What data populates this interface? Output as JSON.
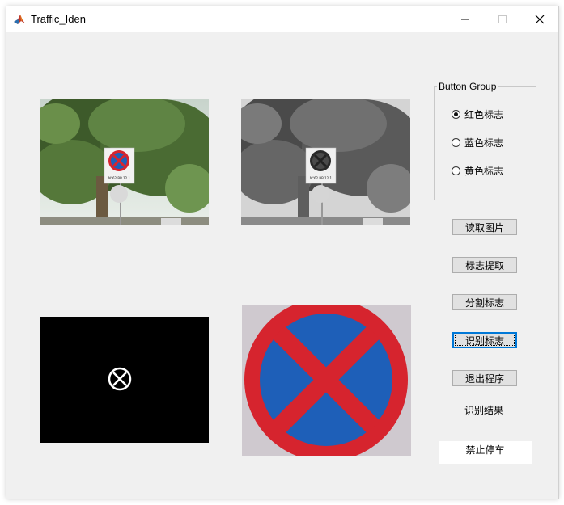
{
  "window": {
    "title": "Traffic_Iden"
  },
  "button_group": {
    "title": "Button Group",
    "options": [
      {
        "label": "红色标志",
        "selected": true
      },
      {
        "label": "蓝色标志",
        "selected": false
      },
      {
        "label": "黄色标志",
        "selected": false
      }
    ]
  },
  "buttons": {
    "read_image": "读取图片",
    "extract_sign": "标志提取",
    "segment_sign": "分割标志",
    "recognize_sign": "识别标志",
    "exit_program": "退出程序"
  },
  "result": {
    "label": "识别结果",
    "value": "禁止停车"
  },
  "images": {
    "plate_text": "N°62 BB 12 1"
  },
  "colors": {
    "window_bg": "#f0f0f0",
    "sign_red": "#d6242e",
    "sign_blue": "#1e5fb8",
    "focus_blue": "#0078d7"
  }
}
